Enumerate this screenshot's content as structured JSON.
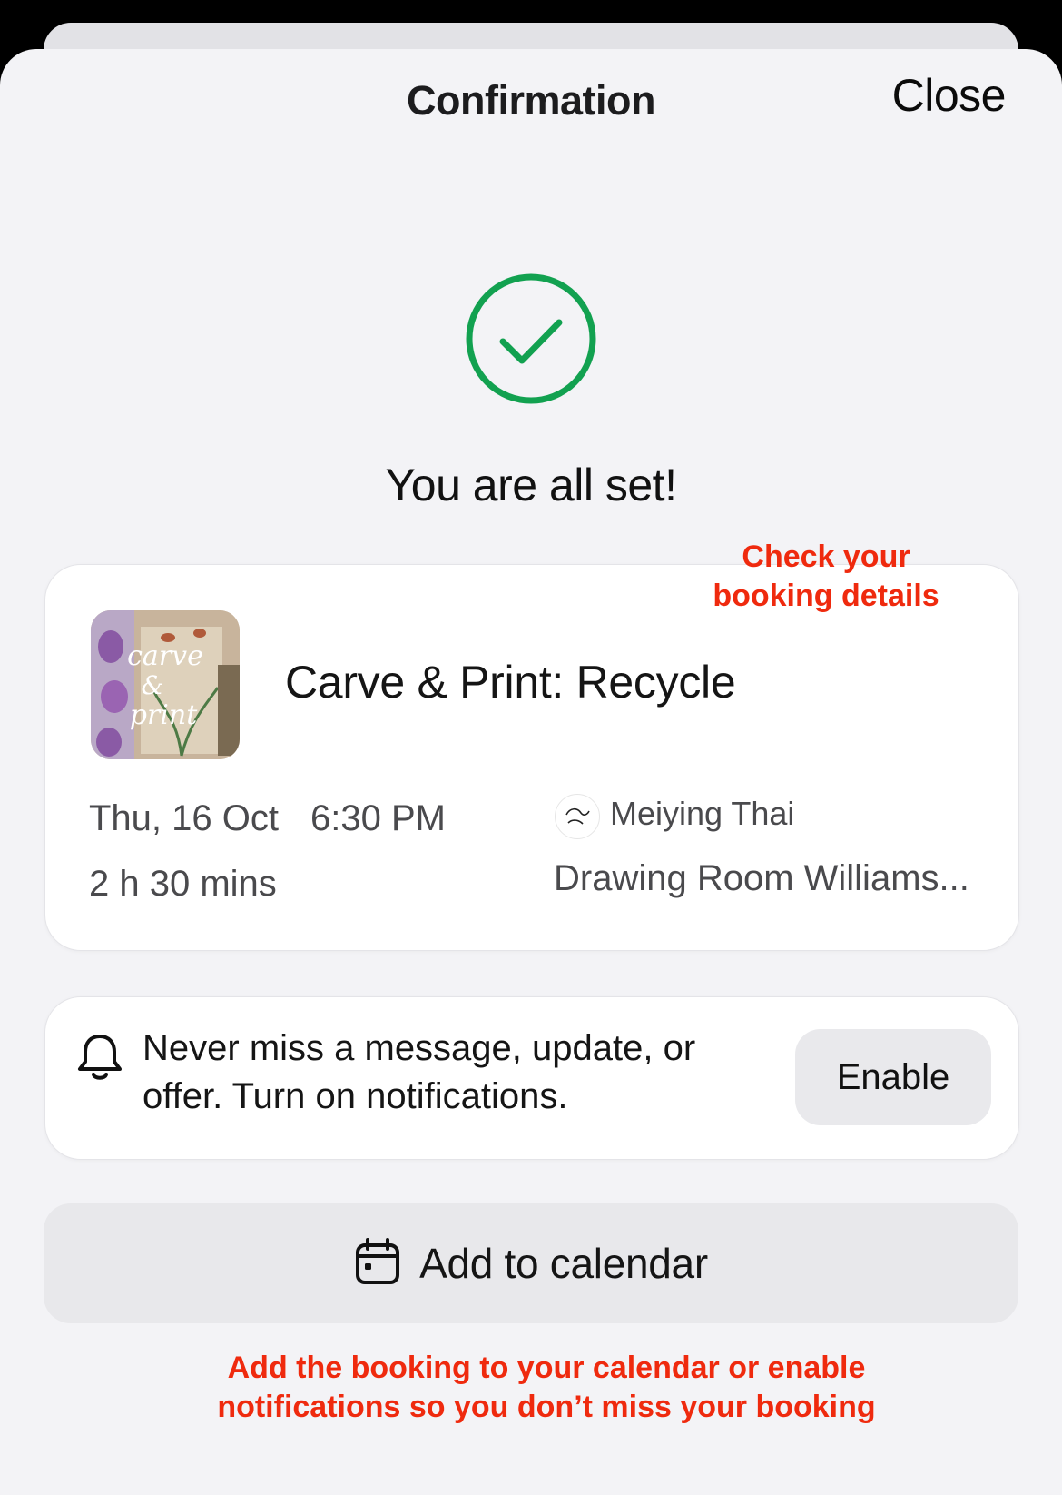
{
  "header": {
    "title": "Confirmation",
    "close_label": "Close"
  },
  "status": {
    "headline": "You are all set!",
    "accent_color": "#12a150"
  },
  "callouts": {
    "booking_details": "Check your booking details",
    "calendar_notifications": "Add the booking to your calendar or enable notifications so you don’t miss your booking",
    "color": "#ef2a0e"
  },
  "booking": {
    "thumbnail_text": "carve & print",
    "title": "Carve & Print: Recycle",
    "date": "Thu, 16 Oct",
    "time": "6:30 PM",
    "duration": "2 h 30 mins",
    "host_name": "Meiying Thai",
    "venue": "Drawing Room Williams..."
  },
  "notifications": {
    "icon": "bell-icon",
    "message": "Never miss a message, update, or offer. Turn on notifications.",
    "enable_label": "Enable"
  },
  "calendar": {
    "icon": "calendar-icon",
    "label": "Add to calendar"
  }
}
